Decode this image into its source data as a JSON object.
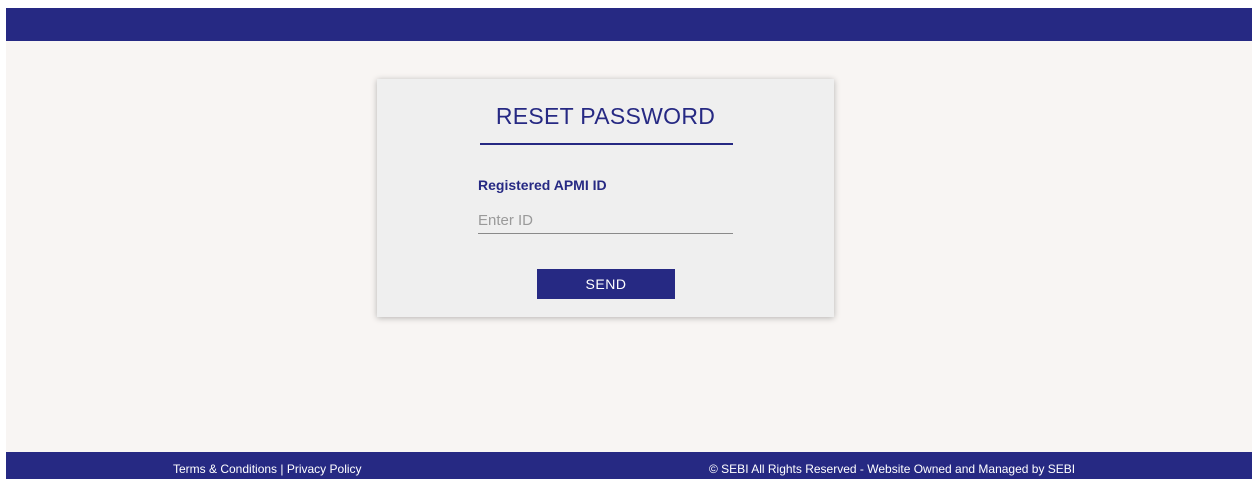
{
  "card": {
    "title": "RESET PASSWORD",
    "field_label": "Registered APMI ID",
    "input_placeholder": "Enter ID",
    "input_value": "",
    "send_label": "SEND"
  },
  "footer": {
    "terms_label": "Terms & Conditions",
    "separator": " | ",
    "privacy_label": "Privacy Policy",
    "copyright": "© SEBI All Rights Reserved - Website Owned and Managed by SEBI"
  },
  "colors": {
    "brand_navy": "#262983",
    "page_background": "#f8f5f3",
    "card_background": "#efefef"
  }
}
